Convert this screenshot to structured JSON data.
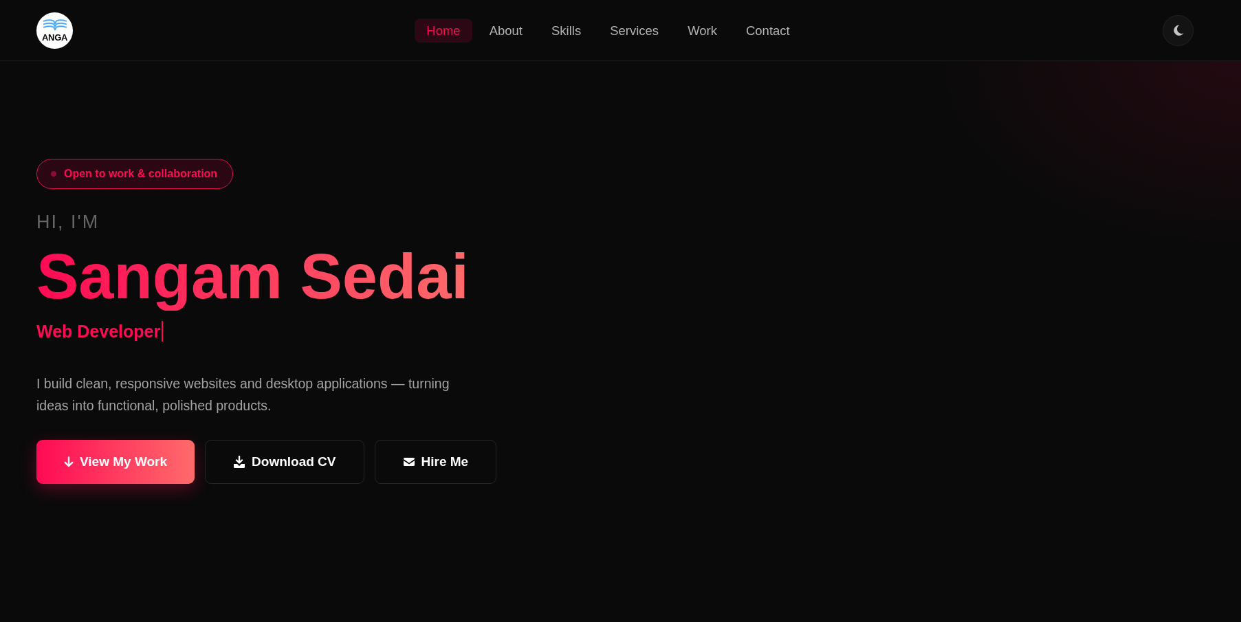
{
  "header": {
    "logo": {
      "text": "ANGA"
    },
    "nav": [
      {
        "label": "Home",
        "selected": true
      },
      {
        "label": "About",
        "selected": false
      },
      {
        "label": "Skills",
        "selected": false
      },
      {
        "label": "Services",
        "selected": false
      },
      {
        "label": "Work",
        "selected": false
      },
      {
        "label": "Contact",
        "selected": false
      }
    ]
  },
  "hero": {
    "badge": {
      "text": "Open to work & collaboration"
    },
    "greeting": "HI, I'M",
    "name": "Sangam Sedai",
    "role": "Web Developer",
    "description": "I build clean, responsive websites and desktop applications — turning ideas into functional, polished products.",
    "buttons": [
      {
        "label": "View My Work",
        "kind": "primary"
      },
      {
        "label": "Download CV",
        "kind": "outline"
      },
      {
        "label": "Hire Me",
        "kind": "outline"
      }
    ]
  }
}
